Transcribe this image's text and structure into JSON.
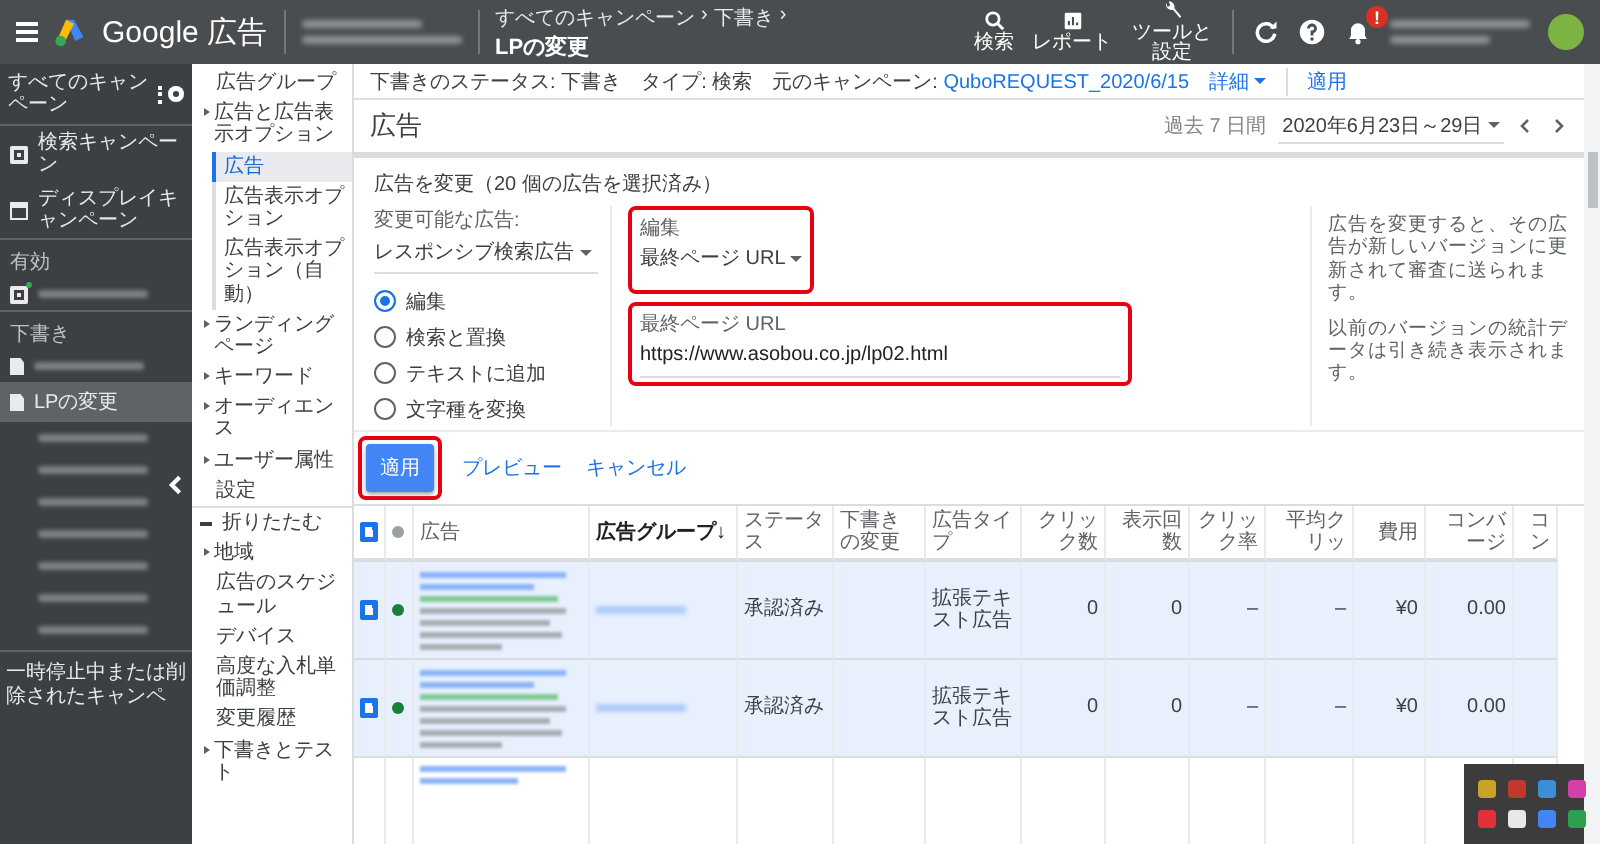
{
  "top_bar": {
    "product": "Google 広告",
    "breadcrumb": [
      "すべてのキャンペーン",
      "下書き"
    ],
    "separator": "›",
    "page_title": "LPの変更",
    "actions": [
      {
        "kind": "search",
        "label": "検索"
      },
      {
        "kind": "report",
        "label": "レポート"
      },
      {
        "kind": "tools",
        "label": "ツールと設定"
      }
    ],
    "notification_badge": "!"
  },
  "sidebar": {
    "header": "すべてのキャンペーン",
    "items": [
      {
        "kind": "search",
        "label": "検索キャンペーン",
        "selected": false
      },
      {
        "kind": "display",
        "label": "ディスプレイキャンペーン",
        "selected": false
      },
      {
        "kind": "section",
        "label": "有効"
      },
      {
        "kind": "blurred-search"
      },
      {
        "kind": "section",
        "label": "下書き"
      },
      {
        "kind": "blurred-doc"
      },
      {
        "kind": "doc",
        "label": "LPの変更",
        "selected": true
      },
      {
        "kind": "blurred"
      },
      {
        "kind": "blurred"
      },
      {
        "kind": "blurred"
      },
      {
        "kind": "blurred"
      },
      {
        "kind": "blurred"
      },
      {
        "kind": "blurred"
      },
      {
        "kind": "blurred"
      }
    ],
    "footer": "一時停止中または削除されたキャンペ"
  },
  "nav": [
    {
      "kind": "item",
      "label": "広告グループ",
      "selected": false
    },
    {
      "kind": "group",
      "label": "広告と広告表示オプション",
      "selected": false
    },
    {
      "kind": "sub",
      "label": "広告",
      "selected": true
    },
    {
      "kind": "sub",
      "label": "広告表示オプション",
      "selected": false
    },
    {
      "kind": "sub",
      "label": "広告表示オプション（自動）",
      "selected": false
    },
    {
      "kind": "group",
      "label": "ランディングページ",
      "selected": false
    },
    {
      "kind": "group",
      "label": "キーワード",
      "selected": false
    },
    {
      "kind": "group",
      "label": "オーディエンス",
      "selected": false
    },
    {
      "kind": "group",
      "label": "ユーザー属性",
      "selected": false
    },
    {
      "kind": "item",
      "label": "設定",
      "selected": false
    },
    {
      "kind": "collapse",
      "label": "折りたたむ",
      "selected": false
    },
    {
      "kind": "group",
      "label": "地域",
      "selected": false
    },
    {
      "kind": "item",
      "label": "広告のスケジュール",
      "selected": false
    },
    {
      "kind": "item",
      "label": "デバイス",
      "selected": false
    },
    {
      "kind": "item",
      "label": "高度な入札単価調整",
      "selected": false
    },
    {
      "kind": "item",
      "label": "変更履歴",
      "selected": false
    },
    {
      "kind": "group",
      "label": "下書きとテスト",
      "selected": false
    }
  ],
  "subheader": {
    "items": [
      {
        "label": "下書きのステータス:",
        "value": "下書き",
        "link": false
      },
      {
        "label": "タイプ:",
        "value": "検索",
        "link": false
      },
      {
        "label": "元のキャンペーン:",
        "value": "QuboREQUEST_2020/6/15",
        "link": true
      }
    ],
    "details": "詳細",
    "apply": "適用"
  },
  "title_row": {
    "title": "広告",
    "range_label": "過去 7 日間",
    "range": "2020年6月23日～29日"
  },
  "edit_card": {
    "title": "広告を変更（20 個の広告を選択済み）",
    "ad_type": {
      "label": "変更可能な広告:",
      "value": "レスポンシブ検索広告"
    },
    "modes": [
      {
        "label": "編集",
        "selected": true
      },
      {
        "label": "検索と置換",
        "selected": false
      },
      {
        "label": "テキストに追加",
        "selected": false
      },
      {
        "label": "文字種を変換",
        "selected": false
      }
    ],
    "edit_field": {
      "label": "編集",
      "value": "最終ページ URL",
      "highlighted": true
    },
    "url_field": {
      "label": "最終ページ URL",
      "value": "https://www.asobou.co.jp/lp02.html",
      "highlighted": true
    },
    "notes": [
      "広告を変更すると、その広告が新しいバージョンに更新されて審査に送られます。",
      "以前のバージョンの統計データは引き続き表示されます。"
    ],
    "apply_button": {
      "label": "適用",
      "highlighted": true
    },
    "preview": "プレビュー",
    "cancel": "キャンセル"
  },
  "table": {
    "header_checked": true,
    "columns": [
      {
        "label": "広告",
        "sorted": false
      },
      {
        "label": "広告グループ",
        "sorted": true,
        "sort_mark": "↓"
      },
      {
        "label": "ステータス",
        "sorted": false
      },
      {
        "label": "下書きの変更",
        "sorted": false
      },
      {
        "label": "広告タイプ",
        "sorted": false
      },
      {
        "label": "クリック数",
        "sorted": false
      },
      {
        "label": "表示回数",
        "sorted": false
      },
      {
        "label": "クリック率",
        "sorted": false
      },
      {
        "label": "平均クリッ",
        "sorted": false
      },
      {
        "label": "費用",
        "sorted": false
      },
      {
        "label": "コンバージ",
        "sorted": false
      },
      {
        "label": "コン",
        "sorted": false
      }
    ],
    "rows": [
      {
        "kind": "full",
        "checked": true,
        "color": "#188038",
        "status": "承認済み",
        "type": "拡張テキスト広告",
        "clicks": "0",
        "impressions": "0",
        "ctr": "–",
        "avg_cpc": "–",
        "cost": "¥0",
        "conversions": "0.00"
      },
      {
        "kind": "full",
        "checked": true,
        "color": "#188038",
        "status": "承認済み",
        "type": "拡張テキスト広告",
        "clicks": "0",
        "impressions": "0",
        "ctr": "–",
        "avg_cpc": "–",
        "cost": "¥0",
        "conversions": "0.00"
      },
      {
        "kind": "cut"
      }
    ]
  },
  "tray": {
    "icons": [
      {
        "color": "#c9a227"
      },
      {
        "color": "#c0392b"
      },
      {
        "color": "#3b8ed8"
      },
      {
        "color": "#d63fa6"
      },
      {
        "color": "#e0303a"
      },
      {
        "color": "#e8e8e8"
      },
      {
        "color": "#4285f4"
      },
      {
        "color": "#2e9e4f"
      }
    ]
  }
}
